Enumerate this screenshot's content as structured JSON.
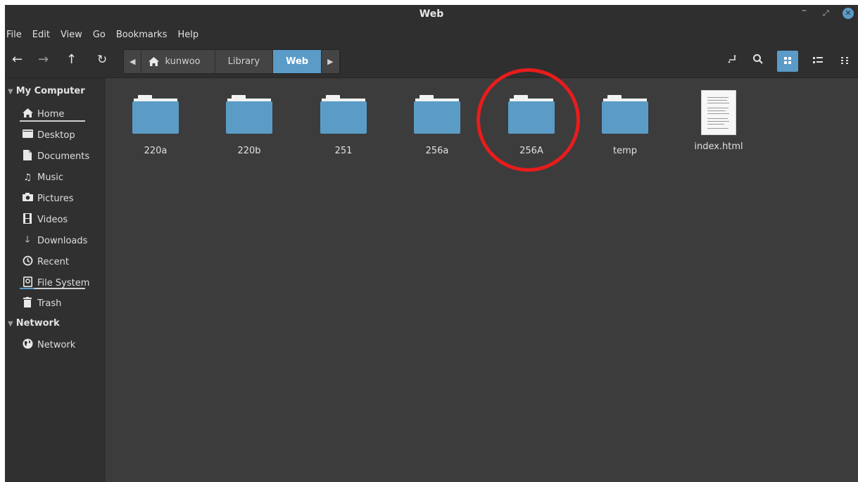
{
  "window": {
    "title": "Web"
  },
  "menubar": [
    "File",
    "Edit",
    "View",
    "Go",
    "Bookmarks",
    "Help"
  ],
  "breadcrumb": [
    {
      "label": "kunwoo",
      "icon": "home-icon",
      "active": false
    },
    {
      "label": "Library",
      "active": false
    },
    {
      "label": "Web",
      "active": true
    }
  ],
  "toolbar": {
    "nav_icons": [
      "back-arrow-icon",
      "forward-arrow-icon",
      "up-arrow-icon",
      "reload-icon"
    ],
    "right_icons": [
      "toggle-location-icon",
      "search-icon",
      "icon-view-icon",
      "list-view-icon",
      "compact-view-icon"
    ],
    "active_view": "icon-view"
  },
  "sidebar": {
    "sections": [
      {
        "label": "My Computer",
        "items": [
          {
            "label": "Home",
            "icon": "home-icon"
          },
          {
            "label": "Desktop",
            "icon": "desktop-icon"
          },
          {
            "label": "Documents",
            "icon": "document-icon"
          },
          {
            "label": "Music",
            "icon": "music-icon"
          },
          {
            "label": "Pictures",
            "icon": "camera-icon"
          },
          {
            "label": "Videos",
            "icon": "film-icon"
          },
          {
            "label": "Downloads",
            "icon": "download-icon"
          },
          {
            "label": "Recent",
            "icon": "recent-icon"
          },
          {
            "label": "File System",
            "icon": "drive-icon"
          },
          {
            "label": "Trash",
            "icon": "trash-icon"
          }
        ]
      },
      {
        "label": "Network",
        "items": [
          {
            "label": "Network",
            "icon": "globe-icon"
          }
        ]
      }
    ]
  },
  "files": [
    {
      "name": "220a",
      "type": "folder"
    },
    {
      "name": "220b",
      "type": "folder"
    },
    {
      "name": "251",
      "type": "folder"
    },
    {
      "name": "256a",
      "type": "folder"
    },
    {
      "name": "256A",
      "type": "folder"
    },
    {
      "name": "temp",
      "type": "folder"
    },
    {
      "name": "index.html",
      "type": "html-file"
    }
  ],
  "colors": {
    "accent": "#5a9bc8",
    "folder": "#5b9cc6",
    "annotation": "#e81c1c"
  }
}
